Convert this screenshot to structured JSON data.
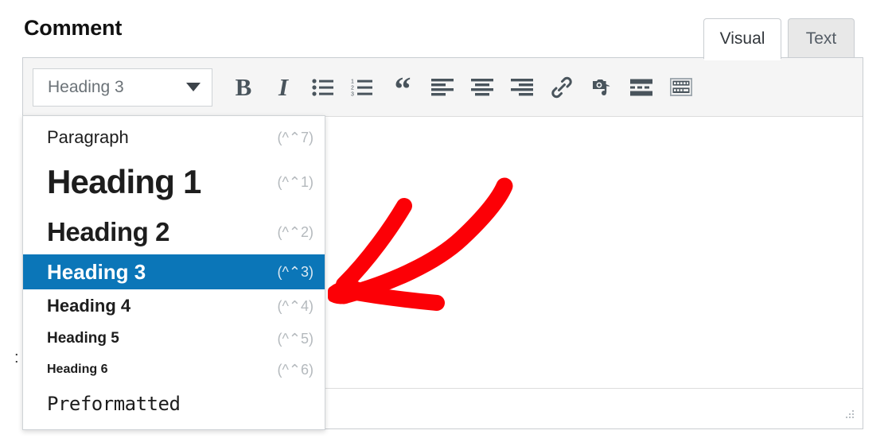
{
  "page": {
    "title": "Comment"
  },
  "tabs": [
    {
      "id": "visual",
      "label": "Visual",
      "active": true
    },
    {
      "id": "text",
      "label": "Text",
      "active": false
    }
  ],
  "toolbar": {
    "format_select": {
      "value": "Heading 3",
      "caret_icon": "chevron-down-icon"
    },
    "buttons": [
      {
        "name": "bold-button",
        "icon": "bold-icon",
        "label": "B"
      },
      {
        "name": "italic-button",
        "icon": "italic-icon",
        "label": "I"
      },
      {
        "name": "bulleted-list-button",
        "icon": "bulleted-list-icon"
      },
      {
        "name": "numbered-list-button",
        "icon": "numbered-list-icon",
        "markers": [
          "1",
          "2",
          "3"
        ]
      },
      {
        "name": "blockquote-button",
        "icon": "blockquote-icon",
        "label": "“"
      },
      {
        "name": "align-left-button",
        "icon": "align-left-icon"
      },
      {
        "name": "align-center-button",
        "icon": "align-center-icon"
      },
      {
        "name": "align-right-button",
        "icon": "align-right-icon"
      },
      {
        "name": "insert-link-button",
        "icon": "link-icon"
      },
      {
        "name": "add-media-button",
        "icon": "media-icon"
      },
      {
        "name": "read-more-button",
        "icon": "read-more-icon"
      },
      {
        "name": "toolbar-toggle-button",
        "icon": "keyboard-toolbar-icon"
      }
    ]
  },
  "dropdown": {
    "open": true,
    "selected": "Heading 3",
    "highlight_color": "#0b76b8",
    "items": [
      {
        "label": "Paragraph",
        "shortcut": "(^⌃7)",
        "style": "paragraph",
        "selected": false
      },
      {
        "label": "Heading 1",
        "shortcut": "(^⌃1)",
        "style": "h1",
        "selected": false
      },
      {
        "label": "Heading 2",
        "shortcut": "(^⌃2)",
        "style": "h2",
        "selected": false
      },
      {
        "label": "Heading 3",
        "shortcut": "(^⌃3)",
        "style": "h3",
        "selected": true
      },
      {
        "label": "Heading 4",
        "shortcut": "(^⌃4)",
        "style": "h4",
        "selected": false
      },
      {
        "label": "Heading 5",
        "shortcut": "(^⌃5)",
        "style": "h5",
        "selected": false
      },
      {
        "label": "Heading 6",
        "shortcut": "(^⌃6)",
        "style": "h6",
        "selected": false
      },
      {
        "label": "Preformatted",
        "shortcut": "",
        "style": "pre",
        "selected": false
      }
    ]
  },
  "editor": {
    "content": "",
    "statusbar_text": "",
    "resize_handle_icon": "resize-grip-icon"
  },
  "annotation": {
    "type": "hand-drawn-arrow",
    "color": "#fc0006",
    "direction": "left",
    "points_to": "Heading 3"
  },
  "obscured_text": ":"
}
